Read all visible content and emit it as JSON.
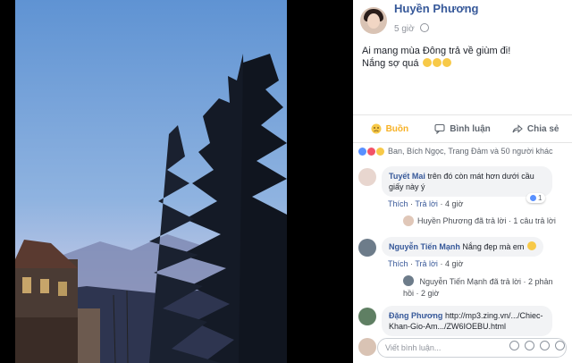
{
  "post": {
    "author": "Huyền Phương",
    "time": "5 giờ",
    "text_line1": "Ai mang mùa Đông trả về giùm đi!",
    "text_line2": "Nắng sợ quá"
  },
  "actions": {
    "react_label": "Buồn",
    "comment_label": "Bình luận",
    "share_label": "Chia sẻ"
  },
  "reactions_summary": "Ban, Bích Ngọc, Trang Đảm và 50 người khác",
  "comments": [
    {
      "name": "Tuyết Mai",
      "text_a": "trên đó còn mát hơn dưới cầu",
      "text_b": "giấy này ý",
      "like_label": "Thích",
      "reply_label": "Trả lời",
      "time": "4 giờ",
      "like_count": "1",
      "reply_author": "Huyền Phương",
      "reply_rest": "đã trả lời · 1 câu trả lời"
    },
    {
      "name": "Nguyễn Tiến Mạnh",
      "text": "Nắng đẹp mà em",
      "like_label": "Thích",
      "reply_label": "Trả lời",
      "time": "4 giờ",
      "reply_author": "Nguyễn Tiến Mạnh",
      "reply_rest": "đã trả lời · 2 phản hồi · 2",
      "reply_tail": "giờ"
    },
    {
      "name": "Đặng Phương",
      "text_a": "http://mp3.zing.vn/.../Chiec-",
      "text_b": "Khan-Gio-Am.../ZW6IOEBU.html"
    }
  ],
  "input": {
    "placeholder": "Viết bình luận..."
  },
  "colors": {
    "accent": "#365899",
    "react": "#f7b125",
    "bubble": "#f2f3f5"
  }
}
